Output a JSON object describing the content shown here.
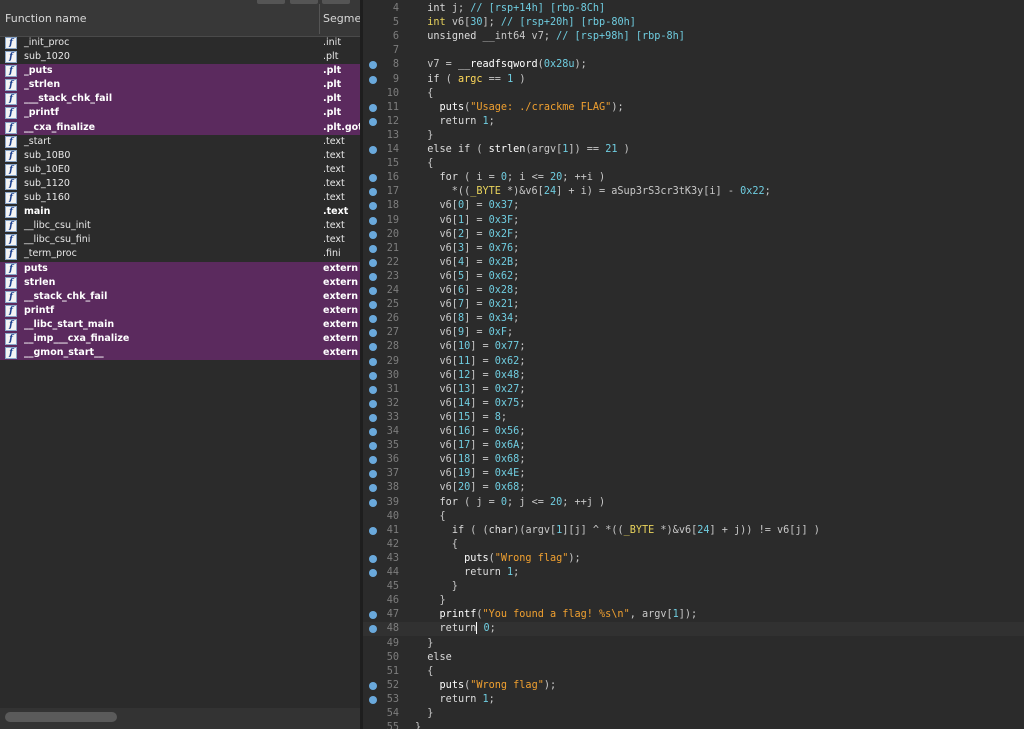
{
  "function_list": {
    "header": {
      "name_col": "Function name",
      "segment_col": "Segme"
    },
    "rows": [
      {
        "name": "_init_proc",
        "segment": ".init",
        "highlighted": false
      },
      {
        "name": "sub_1020",
        "segment": ".plt",
        "highlighted": false
      },
      {
        "name": "_puts",
        "segment": ".plt",
        "highlighted": true
      },
      {
        "name": "_strlen",
        "segment": ".plt",
        "highlighted": true
      },
      {
        "name": "___stack_chk_fail",
        "segment": ".plt",
        "highlighted": true
      },
      {
        "name": "_printf",
        "segment": ".plt",
        "highlighted": true
      },
      {
        "name": "__cxa_finalize",
        "segment": ".plt.got",
        "highlighted": true
      },
      {
        "name": "_start",
        "segment": ".text",
        "highlighted": false
      },
      {
        "name": "sub_10B0",
        "segment": ".text",
        "highlighted": false
      },
      {
        "name": "sub_10E0",
        "segment": ".text",
        "highlighted": false
      },
      {
        "name": "sub_1120",
        "segment": ".text",
        "highlighted": false
      },
      {
        "name": "sub_1160",
        "segment": ".text",
        "highlighted": false
      },
      {
        "name": "main",
        "segment": ".text",
        "highlighted": false,
        "bold": true
      },
      {
        "name": "__libc_csu_init",
        "segment": ".text",
        "highlighted": false
      },
      {
        "name": "__libc_csu_fini",
        "segment": ".text",
        "highlighted": false
      },
      {
        "name": "_term_proc",
        "segment": ".fini",
        "highlighted": false
      },
      {
        "name": "puts",
        "segment": "extern",
        "highlighted": true
      },
      {
        "name": "strlen",
        "segment": "extern",
        "highlighted": true
      },
      {
        "name": "__stack_chk_fail",
        "segment": "extern",
        "highlighted": true
      },
      {
        "name": "printf",
        "segment": "extern",
        "highlighted": true
      },
      {
        "name": "__libc_start_main",
        "segment": "extern",
        "highlighted": true
      },
      {
        "name": "__imp___cxa_finalize",
        "segment": "extern",
        "highlighted": true
      },
      {
        "name": "__gmon_start__",
        "segment": "extern",
        "highlighted": true
      }
    ]
  },
  "pseudocode": {
    "cursor_line": 48,
    "lines": [
      {
        "n": 4,
        "dot": false,
        "html": "  <span class=\"kw\">int</span> j; <span class=\"cm\">// [rsp+14h] [rbp-8Ch]</span>"
      },
      {
        "n": 5,
        "dot": false,
        "html": "  <span class=\"ty\">int</span> v6[<span class=\"num\">30</span>]; <span class=\"cm\">// [rsp+20h] [rbp-80h]</span>"
      },
      {
        "n": 6,
        "dot": false,
        "html": "  <span class=\"kw\">unsigned</span> __int64 v7; <span class=\"cm\">// [rsp+98h] [rbp-8h]</span>"
      },
      {
        "n": 7,
        "dot": false,
        "html": ""
      },
      {
        "n": 8,
        "dot": true,
        "html": "  v7 = <span class=\"fn\">__readfsqword</span>(<span class=\"num\">0x28u</span>);"
      },
      {
        "n": 9,
        "dot": true,
        "html": "  <span class=\"kw\">if</span> ( <span class=\"tl\">argc</span> == <span class=\"num\">1</span> )"
      },
      {
        "n": 10,
        "dot": false,
        "html": "  {"
      },
      {
        "n": 11,
        "dot": true,
        "html": "    <span class=\"fn\">puts</span>(<span class=\"str\">\"Usage: ./crackme FLAG\"</span>);"
      },
      {
        "n": 12,
        "dot": true,
        "html": "    <span class=\"kw\">return</span> <span class=\"num\">1</span>;"
      },
      {
        "n": 13,
        "dot": false,
        "html": "  }"
      },
      {
        "n": 14,
        "dot": true,
        "html": "  <span class=\"kw\">else if</span> ( <span class=\"fn\">strlen</span>(argv[<span class=\"num\">1</span>]) == <span class=\"num\">21</span> )"
      },
      {
        "n": 15,
        "dot": false,
        "html": "  {"
      },
      {
        "n": 16,
        "dot": true,
        "html": "    <span class=\"kw\">for</span> ( i = <span class=\"num\">0</span>; i &lt;= <span class=\"num\">20</span>; ++i )"
      },
      {
        "n": 17,
        "dot": true,
        "html": "      *((<span class=\"ty\">_BYTE</span> *)&amp;v6[<span class=\"num\">24</span>] + i) = aSup3rS3cr3tK3y[i] - <span class=\"num\">0x22</span>;"
      },
      {
        "n": 18,
        "dot": true,
        "html": "    v6[<span class=\"num\">0</span>] = <span class=\"num\">0x37</span>;"
      },
      {
        "n": 19,
        "dot": true,
        "html": "    v6[<span class=\"num\">1</span>] = <span class=\"num\">0x3F</span>;"
      },
      {
        "n": 20,
        "dot": true,
        "html": "    v6[<span class=\"num\">2</span>] = <span class=\"num\">0x2F</span>;"
      },
      {
        "n": 21,
        "dot": true,
        "html": "    v6[<span class=\"num\">3</span>] = <span class=\"num\">0x76</span>;"
      },
      {
        "n": 22,
        "dot": true,
        "html": "    v6[<span class=\"num\">4</span>] = <span class=\"num\">0x2B</span>;"
      },
      {
        "n": 23,
        "dot": true,
        "html": "    v6[<span class=\"num\">5</span>] = <span class=\"num\">0x62</span>;"
      },
      {
        "n": 24,
        "dot": true,
        "html": "    v6[<span class=\"num\">6</span>] = <span class=\"num\">0x28</span>;"
      },
      {
        "n": 25,
        "dot": true,
        "html": "    v6[<span class=\"num\">7</span>] = <span class=\"num\">0x21</span>;"
      },
      {
        "n": 26,
        "dot": true,
        "html": "    v6[<span class=\"num\">8</span>] = <span class=\"num\">0x34</span>;"
      },
      {
        "n": 27,
        "dot": true,
        "html": "    v6[<span class=\"num\">9</span>] = <span class=\"num\">0xF</span>;"
      },
      {
        "n": 28,
        "dot": true,
        "html": "    v6[<span class=\"num\">10</span>] = <span class=\"num\">0x77</span>;"
      },
      {
        "n": 29,
        "dot": true,
        "html": "    v6[<span class=\"num\">11</span>] = <span class=\"num\">0x62</span>;"
      },
      {
        "n": 30,
        "dot": true,
        "html": "    v6[<span class=\"num\">12</span>] = <span class=\"num\">0x48</span>;"
      },
      {
        "n": 31,
        "dot": true,
        "html": "    v6[<span class=\"num\">13</span>] = <span class=\"num\">0x27</span>;"
      },
      {
        "n": 32,
        "dot": true,
        "html": "    v6[<span class=\"num\">14</span>] = <span class=\"num\">0x75</span>;"
      },
      {
        "n": 33,
        "dot": true,
        "html": "    v6[<span class=\"num\">15</span>] = <span class=\"num\">8</span>;"
      },
      {
        "n": 34,
        "dot": true,
        "html": "    v6[<span class=\"num\">16</span>] = <span class=\"num\">0x56</span>;"
      },
      {
        "n": 35,
        "dot": true,
        "html": "    v6[<span class=\"num\">17</span>] = <span class=\"num\">0x6A</span>;"
      },
      {
        "n": 36,
        "dot": true,
        "html": "    v6[<span class=\"num\">18</span>] = <span class=\"num\">0x68</span>;"
      },
      {
        "n": 37,
        "dot": true,
        "html": "    v6[<span class=\"num\">19</span>] = <span class=\"num\">0x4E</span>;"
      },
      {
        "n": 38,
        "dot": true,
        "html": "    v6[<span class=\"num\">20</span>] = <span class=\"num\">0x68</span>;"
      },
      {
        "n": 39,
        "dot": true,
        "html": "    <span class=\"kw\">for</span> ( j = <span class=\"num\">0</span>; j &lt;= <span class=\"num\">20</span>; ++j )"
      },
      {
        "n": 40,
        "dot": false,
        "html": "    {"
      },
      {
        "n": 41,
        "dot": true,
        "html": "      <span class=\"kw\">if</span> ( (<span class=\"kw\">char</span>)(argv[<span class=\"num\">1</span>][j] ^ *((<span class=\"ty\">_BYTE</span> *)&amp;v6[<span class=\"num\">24</span>] + j)) != v6[j] )"
      },
      {
        "n": 42,
        "dot": false,
        "html": "      {"
      },
      {
        "n": 43,
        "dot": true,
        "html": "        <span class=\"fn\">puts</span>(<span class=\"str\">\"Wrong flag\"</span>);"
      },
      {
        "n": 44,
        "dot": true,
        "html": "        <span class=\"kw\">return</span> <span class=\"num\">1</span>;"
      },
      {
        "n": 45,
        "dot": false,
        "html": "      }"
      },
      {
        "n": 46,
        "dot": false,
        "html": "    }"
      },
      {
        "n": 47,
        "dot": true,
        "html": "    <span class=\"fn\">printf</span>(<span class=\"str\">\"You found a flag! %s\\n\"</span>, argv[<span class=\"num\">1</span>]);"
      },
      {
        "n": 48,
        "dot": true,
        "html": "    <span class=\"kw\">return</span><span class=\"caret\"></span> <span class=\"num\">0</span>;"
      },
      {
        "n": 49,
        "dot": false,
        "html": "  }"
      },
      {
        "n": 50,
        "dot": false,
        "html": "  <span class=\"kw\">else</span>"
      },
      {
        "n": 51,
        "dot": false,
        "html": "  {"
      },
      {
        "n": 52,
        "dot": true,
        "html": "    <span class=\"fn\">puts</span>(<span class=\"str\">\"Wrong flag\"</span>);"
      },
      {
        "n": 53,
        "dot": true,
        "html": "    <span class=\"kw\">return</span> <span class=\"num\">1</span>;"
      },
      {
        "n": 54,
        "dot": false,
        "html": "  }"
      },
      {
        "n": 55,
        "dot": false,
        "html": "}"
      }
    ]
  }
}
